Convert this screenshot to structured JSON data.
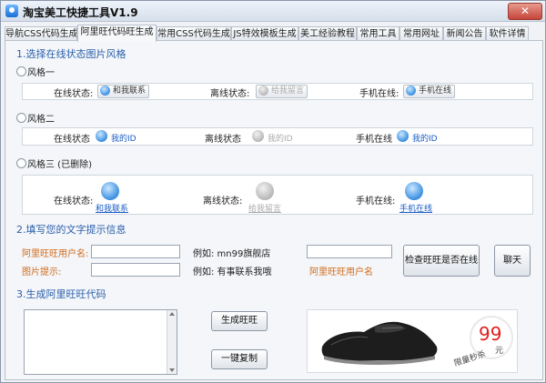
{
  "window": {
    "title": "淘宝美工快捷工具V1.9",
    "close_label": "✕"
  },
  "tabs": [
    {
      "label": "导航CSS代码生成",
      "active": false
    },
    {
      "label": "阿里旺代码旺生成",
      "active": true
    },
    {
      "label": "常用CSS代码生成",
      "active": false
    },
    {
      "label": "JS特效模板生成",
      "active": false
    },
    {
      "label": "美工经验教程",
      "active": false
    },
    {
      "label": "常用工具",
      "active": false
    },
    {
      "label": "常用网址",
      "active": false
    },
    {
      "label": "新闻公告",
      "active": false
    },
    {
      "label": "软件详情",
      "active": false
    }
  ],
  "section1": {
    "title": "1.选择在线状态图片风格",
    "style1": {
      "label": "风格一",
      "online_label": "在线状态:",
      "online_pill": "和我联系",
      "offline_label": "离线状态:",
      "offline_pill": "给我留言",
      "mobile_label": "手机在线:",
      "mobile_pill": "手机在线"
    },
    "style2": {
      "label": "风格二",
      "online_label": "在线状态",
      "online_id": "我的ID",
      "offline_label": "离线状态",
      "offline_id": "我的ID",
      "mobile_label": "手机在线",
      "mobile_id": "我的ID"
    },
    "style3": {
      "label": "风格三 (已删除)",
      "online_label": "在线状态:",
      "online_link": "和我联系",
      "offline_label": "离线状态:",
      "offline_link": "给我留言",
      "mobile_label": "手机在线:",
      "mobile_link": "手机在线"
    }
  },
  "section2": {
    "title": "2.填写您的文字提示信息",
    "username_label": "阿里旺旺用户名:",
    "username_value": "",
    "username_example": "例如: mn99旗舰店",
    "hint_label": "图片提示:",
    "hint_value": "",
    "hint_example": "例如: 有事联系我哦",
    "check_input_value": "",
    "check_input_caption": "阿里旺旺用户名",
    "check_button": "检查旺旺是否在线",
    "chat_button": "聊天"
  },
  "section3": {
    "title": "3.生成阿里旺旺代码",
    "code_value": "",
    "generate_button": "生成旺旺",
    "copy_button": "一键复制",
    "banner": {
      "price": "99",
      "unit": "元",
      "promo": "限量秒杀"
    }
  },
  "colors": {
    "accent_blue": "#2a5fab",
    "orange_label": "#d26b1a",
    "price_red": "#e02020"
  }
}
